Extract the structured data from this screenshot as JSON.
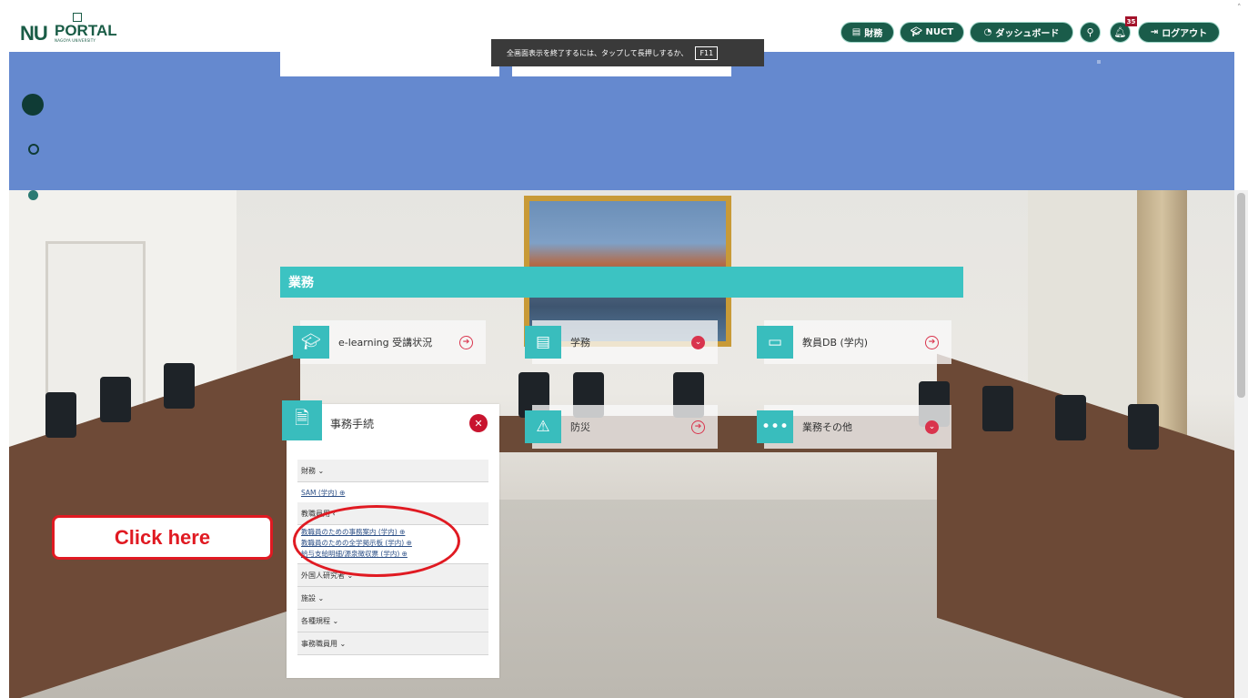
{
  "header": {
    "logo_text": "NU",
    "logo_portal": "PORTAL",
    "logo_university": "NAGOYA UNIVERSITY",
    "btn_finance": "財務",
    "btn_nuct": "NUCT",
    "btn_dashboard": "ダッシュボード",
    "btn_logout": "ログアウト",
    "notification_count": "35"
  },
  "fullscreen_banner": {
    "text": "全画面表示を終了するには、タップして長押しするか、",
    "key": "F11"
  },
  "section": {
    "title": "業務"
  },
  "tiles": [
    {
      "label": "e-learning 受講状況",
      "icon": "graduation-cap-icon"
    },
    {
      "label": "学務",
      "icon": "book-icon"
    },
    {
      "label": "教員DB (学内)",
      "icon": "id-card-icon"
    },
    {
      "label": "防災",
      "icon": "warning-icon"
    },
    {
      "label": "業務その他",
      "icon": "more-icon"
    }
  ],
  "panel": {
    "title": "事務手続",
    "categories": {
      "finance": "財務 ⌄",
      "sam": "SAM (学内) ⊕",
      "staff": "教職員用 ‹",
      "staff_links": [
        "教職員のための事務案内 (学内) ⊕",
        "教職員のための全学掲示板 (学内) ⊕",
        "給与支給明細/源泉徴収票 (学内) ⊕"
      ],
      "foreign": "外国人研究者 ⌄",
      "facilities": "施設 ⌄",
      "regulations": "各種規程 ⌄",
      "office_staff": "事務職員用 ⌄"
    }
  },
  "annotation": {
    "click_here": "Click here",
    "color": "#e01a22"
  },
  "colors": {
    "brand": "#1a5c4a",
    "accent": "#3cc3c2",
    "band": "#6589cf",
    "alert": "#d9344d"
  }
}
